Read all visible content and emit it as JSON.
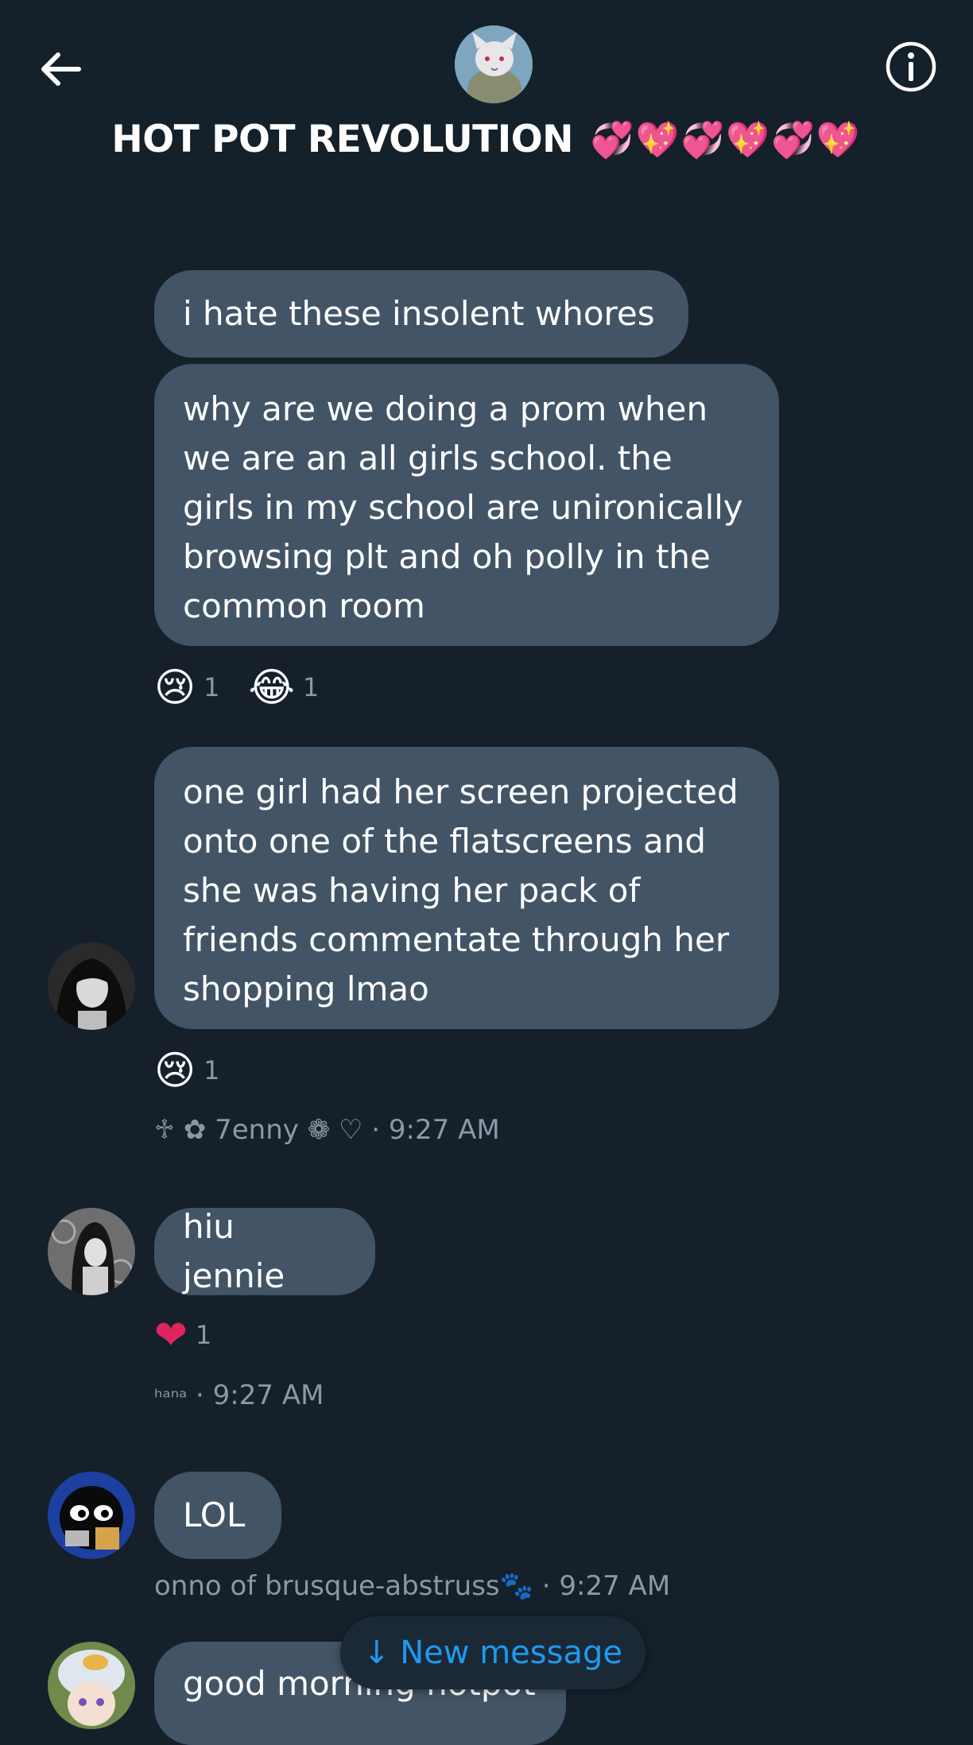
{
  "header": {
    "title": "HOT POT REVOLUTION",
    "title_emoji": "💞💖💞💖💞💖"
  },
  "messages": {
    "m1": "i hate these insolent whores",
    "m2_lines": [
      "why are we doing a prom when",
      "we are an all girls school. the",
      "girls in my school are unironically",
      "browsing plt and oh polly in the",
      "common room"
    ],
    "m2_reactions": [
      {
        "emoji": "😢",
        "count": "1"
      },
      {
        "emoji": "😂",
        "count": "1"
      }
    ],
    "m3_lines": [
      "one girl had her screen projected",
      "onto one of the flatscreens and",
      "she was having her pack of",
      "friends commentate through her",
      "shopping lmao"
    ],
    "m3_reactions": [
      {
        "emoji": "😢",
        "count": "1"
      }
    ],
    "m3_meta": "♱ ✿ 7enny ❁ ♡ · 9:27 AM",
    "m4": "hiu jennie",
    "m4_reactions": [
      {
        "emoji": "❤",
        "count": "1"
      }
    ],
    "m4_sender": "ʰᵃⁿᵃ",
    "m4_time": "· 9:27 AM",
    "m5": "LOL",
    "m5_meta": "onno of brusque-abstruss🐾 · 9:27 AM",
    "m6": "good morning hotpot"
  },
  "new_message_pill": {
    "label": "↓ New message"
  },
  "colors": {
    "background": "#15202b",
    "bubble": "#425466",
    "meta_text": "#8b98a5",
    "accent": "#1d9bf0"
  },
  "icons": [
    "back-arrow-icon",
    "info-icon"
  ]
}
